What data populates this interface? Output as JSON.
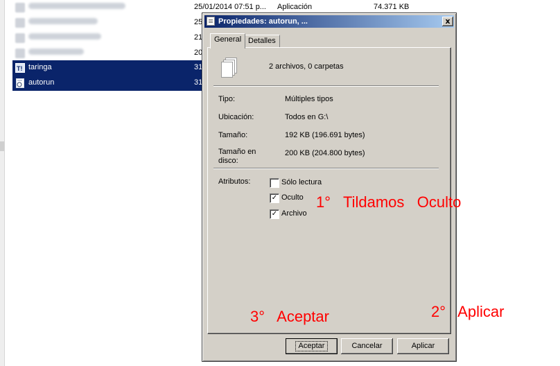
{
  "explorer": {
    "top_row": {
      "date": "25/01/2014 07:51 p...",
      "type": "Aplicación",
      "size": "74.371 KB"
    },
    "rows": [
      {
        "date": "25"
      },
      {
        "date": "21"
      },
      {
        "date": "20"
      }
    ],
    "selected_rows": [
      {
        "name": "taringa",
        "date": "31",
        "icon": "exe-icon"
      },
      {
        "name": "autorun",
        "date": "31",
        "icon": "settings-file-icon"
      }
    ]
  },
  "dialog": {
    "title": "Propiedades: autorun, ...",
    "close_label": "x",
    "tabs": [
      {
        "label": "General"
      },
      {
        "label": "Detalles"
      }
    ],
    "summary": "2 archivos, 0 carpetas",
    "fields": {
      "tipo_label": "Tipo:",
      "tipo_value": "Múltiples tipos",
      "ubicacion_label": "Ubicación:",
      "ubicacion_value": "Todos en G:\\",
      "tamano_label": "Tamaño:",
      "tamano_value": "192 KB (196.691 bytes)",
      "tamano_disco_label_1": "Tamaño en",
      "tamano_disco_label_2": "disco:",
      "tamano_disco_value": "200 KB (204.800 bytes)"
    },
    "attributes_label": "Atributos:",
    "attributes": [
      {
        "label": "Sólo lectura",
        "checked": false
      },
      {
        "label": "Oculto",
        "checked": true
      },
      {
        "label": "Archivo",
        "checked": true
      }
    ],
    "check_mark": "✓",
    "buttons": {
      "accept": "Aceptar",
      "cancel": "Cancelar",
      "apply": "Aplicar"
    }
  },
  "annotations": {
    "step1": "1°   Tildamos   Oculto",
    "step2": "2°   Aplicar",
    "step3": "3°   Aceptar",
    "color": "#ff0000"
  }
}
